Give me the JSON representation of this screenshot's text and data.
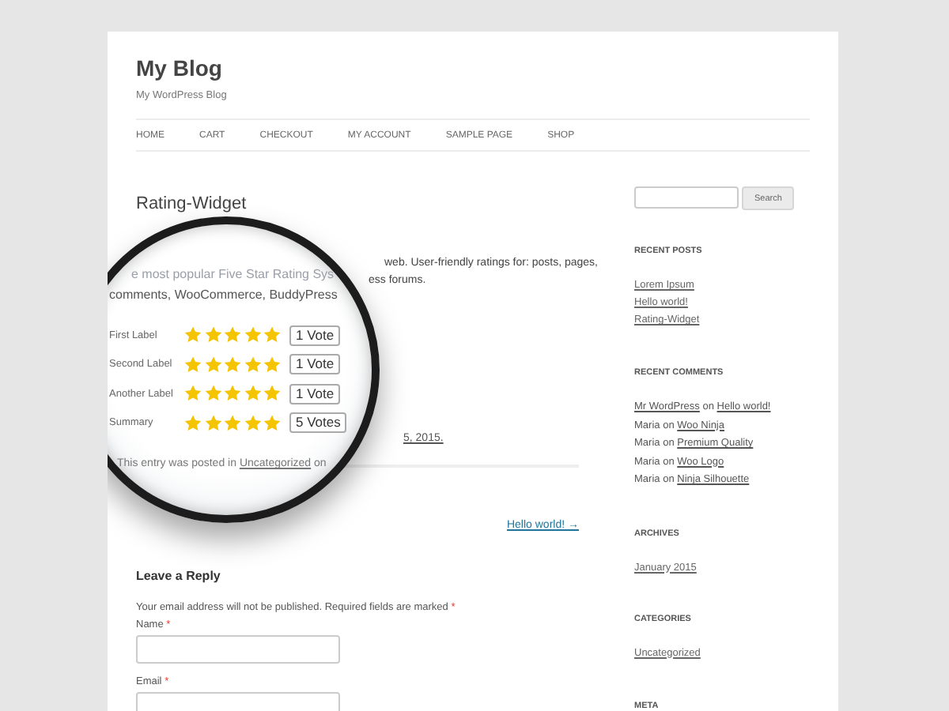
{
  "site": {
    "title": "My Blog",
    "tagline": "My WordPress Blog"
  },
  "nav": [
    "HOME",
    "CART",
    "CHECKOUT",
    "MY ACCOUNT",
    "SAMPLE PAGE",
    "SHOP"
  ],
  "post": {
    "title": "Rating-Widget",
    "excerpt_lines": [
      "web. User-friendly ratings for: posts, pages,",
      "ess forums."
    ],
    "date_fragment": "5, 2015.",
    "magnifier": {
      "faded_line": "e most popular Five Star Rating Sys",
      "text_line": "comments, WooCommerce, BuddyPress",
      "ratings": [
        {
          "label": "First Label",
          "stars": 5,
          "votes": "1 Vote"
        },
        {
          "label": "Second Label",
          "stars": 5,
          "votes": "1 Vote"
        },
        {
          "label": "Another Label",
          "stars": 5,
          "votes": "1 Vote"
        },
        {
          "label": "Summary",
          "stars": 5,
          "votes": "5 Votes"
        }
      ],
      "footer_prefix": "This entry was posted in",
      "footer_link": "Uncategorized",
      "footer_suffix": "on"
    }
  },
  "next_link": "Hello world! →",
  "reply": {
    "title": "Leave a Reply",
    "note": "Your email address will not be published. Required fields are marked",
    "required_mark": "*",
    "fields": [
      {
        "label": "Name",
        "required": true
      },
      {
        "label": "Email",
        "required": true
      }
    ]
  },
  "sidebar": {
    "search_button": "Search",
    "recent_posts": {
      "title": "RECENT POSTS",
      "items": [
        "Lorem Ipsum",
        "Hello world!",
        "Rating-Widget"
      ]
    },
    "recent_comments": {
      "title": "RECENT COMMENTS",
      "items": [
        {
          "author": "Mr WordPress",
          "author_is_link": true,
          "joiner": "on",
          "post": "Hello world!"
        },
        {
          "author": "Maria",
          "author_is_link": false,
          "joiner": "on",
          "post": "Woo Ninja"
        },
        {
          "author": "Maria",
          "author_is_link": false,
          "joiner": "on",
          "post": "Premium Quality"
        },
        {
          "author": "Maria",
          "author_is_link": false,
          "joiner": "on",
          "post": "Woo Logo"
        },
        {
          "author": "Maria",
          "author_is_link": false,
          "joiner": "on",
          "post": "Ninja Silhouette"
        }
      ]
    },
    "archives": {
      "title": "ARCHIVES",
      "items": [
        "January 2015"
      ]
    },
    "categories": {
      "title": "CATEGORIES",
      "items": [
        "Uncategorized"
      ]
    },
    "meta": {
      "title": "META"
    }
  }
}
